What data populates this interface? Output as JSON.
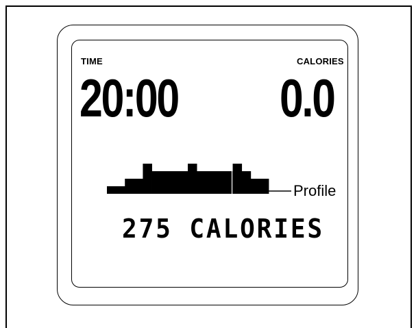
{
  "console": {
    "time_label": "TIME",
    "time_value": "20:00",
    "calories_label": "CALORIES",
    "calories_value": "0.0",
    "profile_label": "Profile",
    "message": "275 CALORIES"
  },
  "profile": {
    "levels": [
      1,
      1,
      2,
      2,
      4,
      3,
      3,
      3,
      3,
      4,
      3,
      3,
      3,
      3,
      4,
      3,
      2,
      2
    ]
  }
}
